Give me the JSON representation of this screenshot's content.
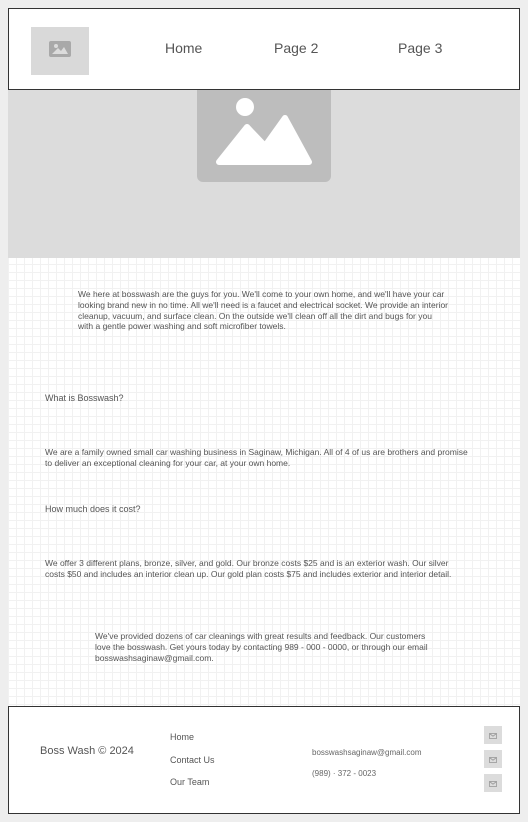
{
  "header": {
    "logo_icon": "image-placeholder-icon",
    "nav": [
      "Home",
      "Page 2",
      "Page 3"
    ]
  },
  "hero": {
    "image_icon": "image-placeholder-icon"
  },
  "content": {
    "intro": "We here at bosswash are the guys for you. We'll come to your own home, and we'll have your car looking brand new in no time. All we'll need is a faucet and electrical socket. We provide an interior cleanup, vacuum, and surface clean. On the outside we'll clean off all the dirt and bugs for you with a gentle power washing and soft microfiber towels.",
    "about_heading": "What is Bosswash?",
    "about_text": "We are a family owned small car washing business in Saginaw, Michigan. All of 4 of us are brothers and promise to deliver an exceptional cleaning for your car, at your own home.",
    "cost_heading": "How much does it cost?",
    "cost_text": "We offer 3 different plans, bronze, silver, and gold. Our bronze costs $25 and is an exterior wash. Our silver costs $50 and includes an interior clean up. Our gold plan costs $75 and includes exterior and interior detail.",
    "closing_text": "We've provided dozens of car cleanings with great results and feedback. Our customers love the bosswash. Get yours today by contacting 989 - 000 - 0000, or through our email bosswashsaginaw@gmail.com."
  },
  "footer": {
    "brand": "Boss Wash © 2024",
    "links": [
      "Home",
      "Contact Us",
      "Our Team"
    ],
    "email": "bosswashsaginaw@gmail.com",
    "phone": "(989) · 372 - 0023",
    "social_icons": [
      "mail-icon",
      "mail-icon",
      "mail-icon"
    ]
  }
}
